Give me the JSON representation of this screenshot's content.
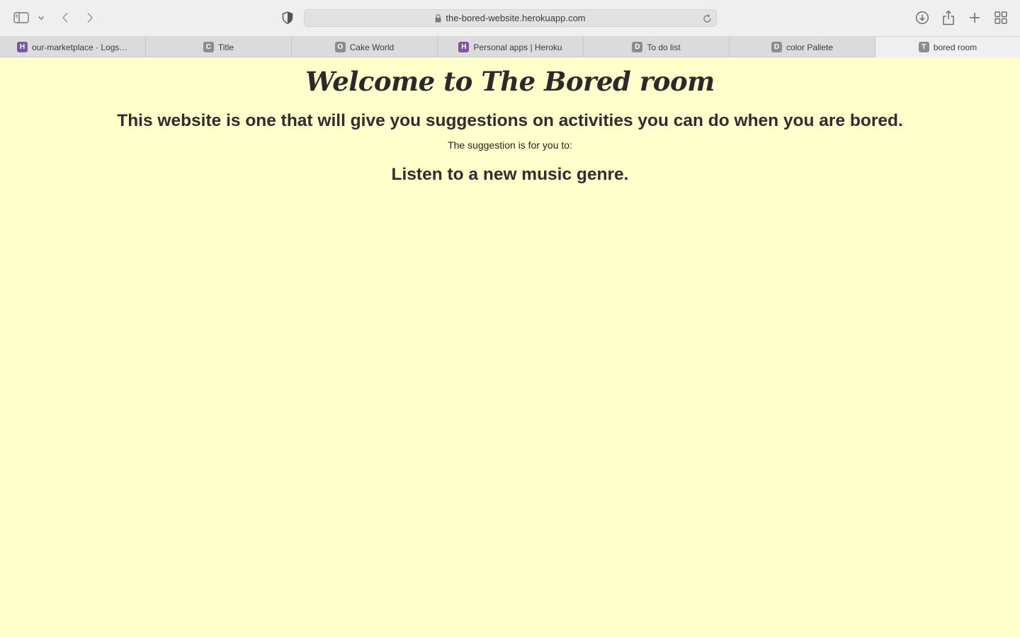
{
  "browser": {
    "url": "the-bored-website.herokuapp.com",
    "tabs": [
      {
        "label": "our-marketplace · Logs |...",
        "favicon": "H",
        "favicon_style": "heroku"
      },
      {
        "label": "Title",
        "favicon": "C",
        "favicon_style": "letter"
      },
      {
        "label": "Cake World",
        "favicon": "O",
        "favicon_style": "letter"
      },
      {
        "label": "Personal apps | Heroku",
        "favicon": "H",
        "favicon_style": "heroku"
      },
      {
        "label": "To do list",
        "favicon": "D",
        "favicon_style": "letter"
      },
      {
        "label": "color Pallete",
        "favicon": "D",
        "favicon_style": "letter"
      },
      {
        "label": "bored room",
        "favicon": "T",
        "favicon_style": "letter",
        "active": true
      }
    ],
    "icons": [
      "sidebar-icon",
      "chevron-down-icon",
      "back-icon",
      "forward-icon",
      "shield-icon",
      "lock-icon",
      "reload-icon",
      "download-icon",
      "share-icon",
      "plus-icon",
      "tab-overview-icon"
    ]
  },
  "page": {
    "title": "Welcome to The Bored room",
    "subtitle": "This website is one that will give you suggestions on activities you can do when you are bored.",
    "suggestion_label": "The suggestion is for you to:",
    "suggestion": "Listen to a new music genre.",
    "background_color": "#ffffcc"
  }
}
